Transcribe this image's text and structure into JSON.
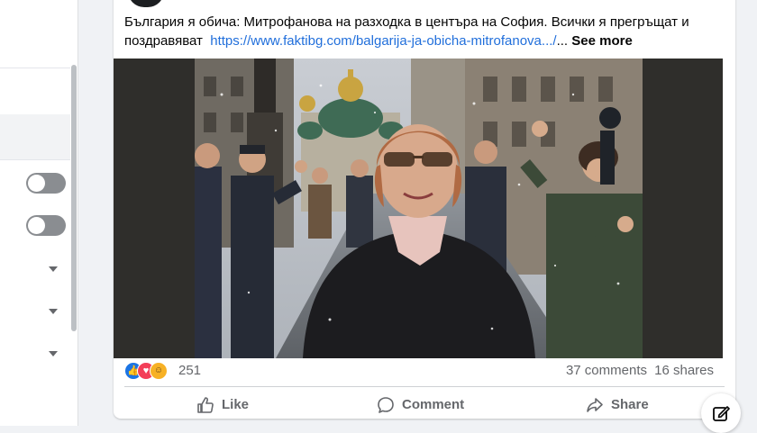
{
  "post": {
    "title_text": "България я обича: Митрофанова на разходка в центъра на София. Всички я прегръщат и поздравяват",
    "link_text": "https://www.faktibg.com/balgarija-ja-obicha-mitrofanova.../",
    "ellipsis": "...",
    "see_more": "See more"
  },
  "stats": {
    "reaction_count": "251",
    "comments": "37 comments",
    "shares": "16 shares",
    "reactions": [
      "like",
      "love",
      "haha"
    ]
  },
  "actions": {
    "like": "Like",
    "comment": "Comment",
    "share": "Share"
  },
  "left_panel": {
    "toggles": [
      "off",
      "off"
    ],
    "dropdowns": 3
  },
  "icons": {
    "like": "thumbs-up-icon",
    "comment": "speech-bubble-icon",
    "share": "share-arrow-icon",
    "compose": "compose-icon"
  },
  "colors": {
    "link": "#216fdb",
    "like_reaction": "#1b74e4",
    "love_reaction": "#f33e58",
    "haha_reaction": "#f7b125",
    "secondary_text": "#65676b"
  }
}
